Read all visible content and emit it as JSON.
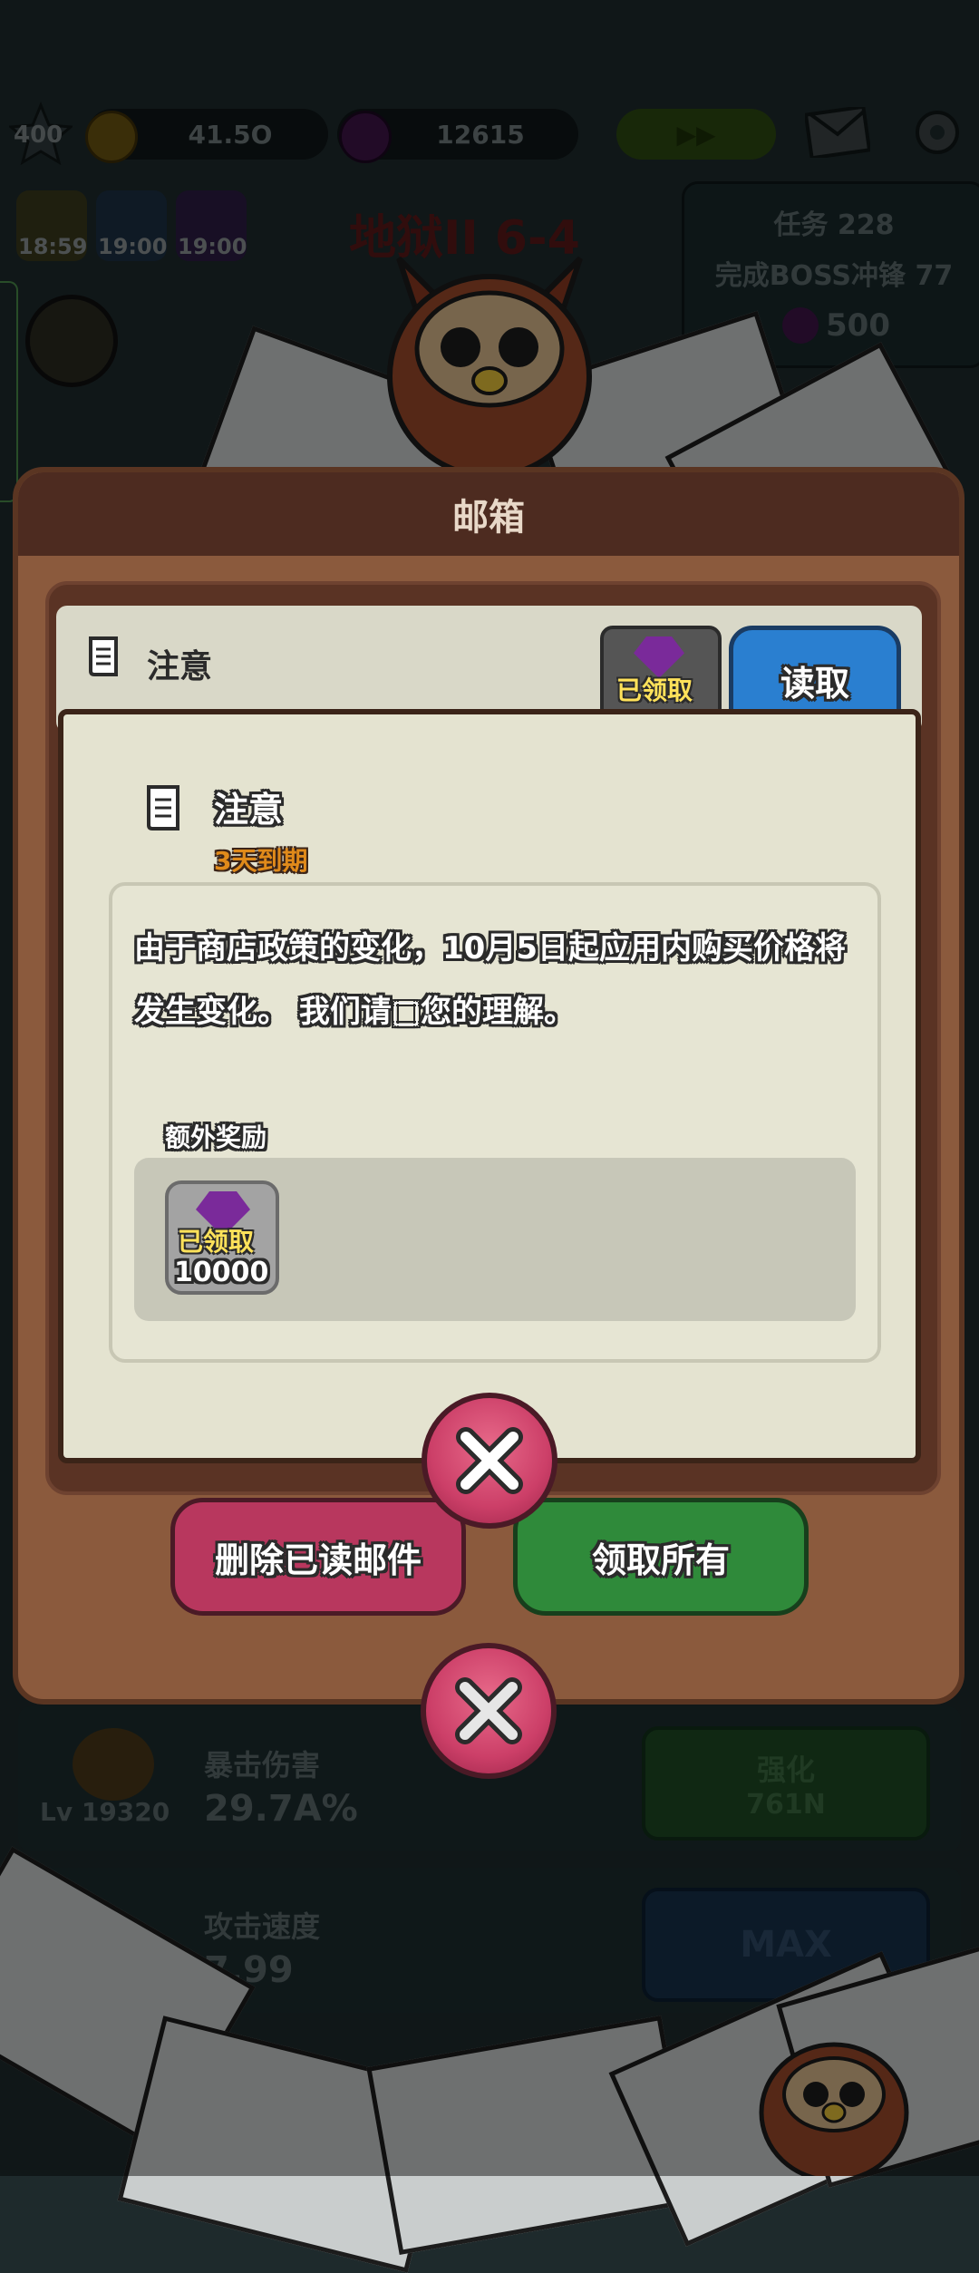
{
  "hud": {
    "level": "400",
    "gold": "41.5O",
    "gems": "12615",
    "timers": [
      "18:59",
      "19:00",
      "19:00"
    ],
    "stage": "地狱II 6-4",
    "quest_title": "任务 228",
    "quest_desc": "完成BOSS冲锋 77",
    "quest_reward": "500"
  },
  "dialog": {
    "title": "邮箱",
    "mail_item": {
      "title": "注意",
      "status": "已领取",
      "read_button": "读取"
    },
    "delete_read_button": "删除已读邮件",
    "claim_all_button": "领取所有"
  },
  "popup": {
    "title": "注意",
    "expiry": "3天到期",
    "body": "由于商店政策的变化，10月5日起应用内购买价格将发生变化。 我们请□您的理解。",
    "bonus_label": "额外奖励",
    "reward": {
      "status": "已领取",
      "amount": "10000",
      "icon": "purple-gem-icon"
    }
  },
  "stats": [
    {
      "level": "Lv 19320",
      "name": "暴击伤害",
      "value": "29.7A%",
      "button": "强化",
      "cost": "761N"
    },
    {
      "name": "攻击速度",
      "value": "7.99",
      "button": "MAX"
    }
  ],
  "colors": {
    "accent_pink": "#cc3f68",
    "accent_green": "#2f8a3a",
    "accent_blue": "#2a7fd0",
    "gem_purple": "#7a2a9a",
    "expiry_orange": "#e08a1a"
  }
}
